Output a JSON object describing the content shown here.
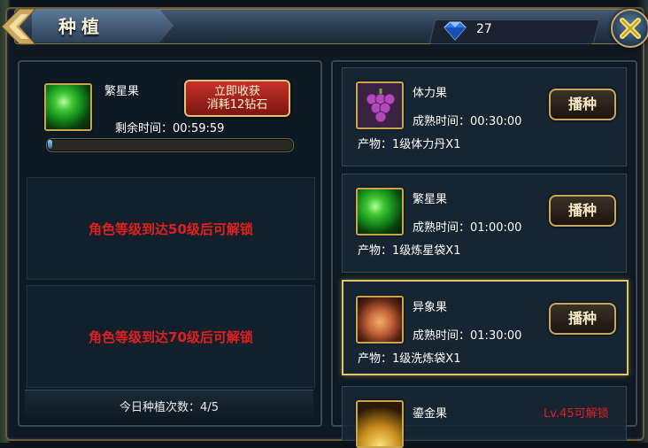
{
  "window": {
    "title": "种植"
  },
  "currency": {
    "icon": "diamond-icon",
    "count": "27"
  },
  "active_slot": {
    "fruit_name": "繁星果",
    "timer_label": "剩余时间：",
    "timer_value": "00:59:59",
    "progress": 0.02,
    "harvest_button": {
      "line1": "立即收获",
      "line2": "消耗12钻石"
    }
  },
  "locked_slots": [
    {
      "message": "角色等级到达50级后可解锁"
    },
    {
      "message": "角色等级到达70级后可解锁"
    }
  ],
  "daily_count": {
    "label": "今日种植次数：",
    "value": "4/5"
  },
  "seeds": [
    {
      "name": "体力果",
      "time_label": "成熟时间：",
      "time": "00:30:00",
      "output_label": "产物：",
      "output": "1级体力丹X1",
      "button": "播种",
      "icon": "grapes-icon"
    },
    {
      "name": "繁星果",
      "time_label": "成熟时间：",
      "time": "01:00:00",
      "output_label": "产物：",
      "output": "1级炼星袋X1",
      "button": "播种",
      "icon": "green-orb-icon"
    },
    {
      "name": "异象果",
      "time_label": "成熟时间：",
      "time": "01:30:00",
      "output_label": "产物：",
      "output": "1级洗炼袋X1",
      "button": "播种",
      "icon": "peach-icon",
      "selected": true
    },
    {
      "name": "鎏金果",
      "lock": "Lv.45可解锁",
      "icon": "gold-fruit-icon"
    }
  ],
  "colors": {
    "accent_gold": "#c9a660",
    "lock_red": "#e02020",
    "panel_bg": "#0e1a23"
  }
}
